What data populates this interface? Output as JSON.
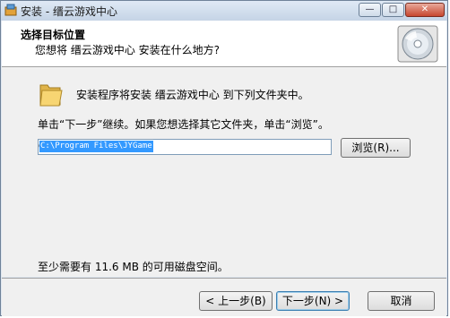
{
  "window": {
    "title": "安装 - 缙云游戏中心",
    "controls": {
      "minimize": "—",
      "maximize": "□",
      "close": "✕"
    }
  },
  "header": {
    "title": "选择目标位置",
    "subtitle": "您想将 缙云游戏中心 安装在什么地方?"
  },
  "content": {
    "install_message": "安装程序将安装 缙云游戏中心 到下列文件夹中。",
    "instruction": "单击“下一步”继续。如果您想选择其它文件夹，单击“浏览”。",
    "install_path": "C:\\Program Files\\JYGame",
    "browse_label": "浏览(R)...",
    "disk_space": "至少需要有 11.6 MB 的可用磁盘空间。"
  },
  "footer": {
    "back_label": "< 上一步(B)",
    "next_label": "下一步(N) >",
    "cancel_label": "取消"
  },
  "colors": {
    "selection": "#3399ff",
    "close_button": "#c7462f",
    "panel": "#f0f0f0"
  }
}
